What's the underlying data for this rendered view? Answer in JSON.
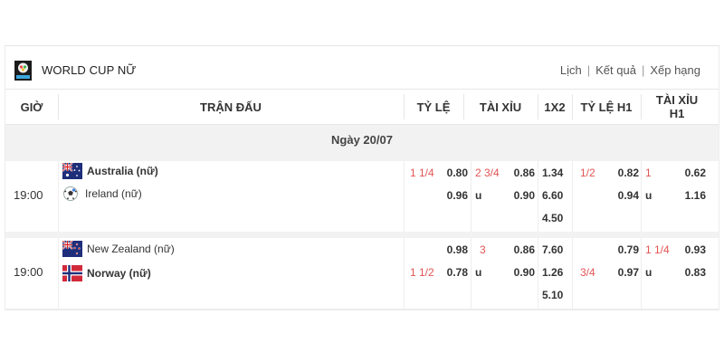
{
  "league": {
    "title": "WORLD CUP NỮ",
    "links": [
      "Lịch",
      "Kết quả",
      "Xếp hạng"
    ]
  },
  "columns": {
    "time": "GIỜ",
    "match": "TRẬN ĐẤU",
    "handicap": "TỶ LỆ",
    "over_under": "TÀI XỈU",
    "x12": "1X2",
    "handicap_h1": "TỶ LỆ H1",
    "over_under_h1_line1": "TÀI XỈU",
    "over_under_h1_line2": "H1"
  },
  "date_label": "Ngày 20/07",
  "matches": [
    {
      "time": "19:00",
      "home": "Australia (nữ)",
      "away": "Ireland (nữ)",
      "handicap": {
        "line": "1 1/4",
        "home": "0.80",
        "away": "0.96"
      },
      "over_under": {
        "line": "2 3/4",
        "over": "0.86",
        "under_label": "u",
        "under": "0.90"
      },
      "x12": [
        "1.34",
        "6.60",
        "4.50"
      ],
      "handicap_h1": {
        "line": "1/2",
        "home": "0.82",
        "away": "0.94"
      },
      "over_under_h1": {
        "line": "1",
        "over": "0.62",
        "under_label": "u",
        "under": "1.16"
      }
    },
    {
      "time": "19:00",
      "home": "New Zealand (nữ)",
      "away": "Norway (nữ)",
      "handicap": {
        "line": "1 1/2",
        "home": "0.98",
        "away": "0.78"
      },
      "over_under": {
        "line": "3",
        "over": "0.86",
        "under_label": "u",
        "under": "0.90"
      },
      "x12": [
        "7.60",
        "1.26",
        "5.10"
      ],
      "handicap_h1": {
        "line": "3/4",
        "home": "0.79",
        "away": "0.97"
      },
      "over_under_h1": {
        "line": "1 1/4",
        "over": "0.93",
        "under_label": "u",
        "under": "0.83"
      }
    }
  ],
  "colors": {
    "accent_red": "#e35454",
    "row_bg": "#f2f2f2"
  }
}
